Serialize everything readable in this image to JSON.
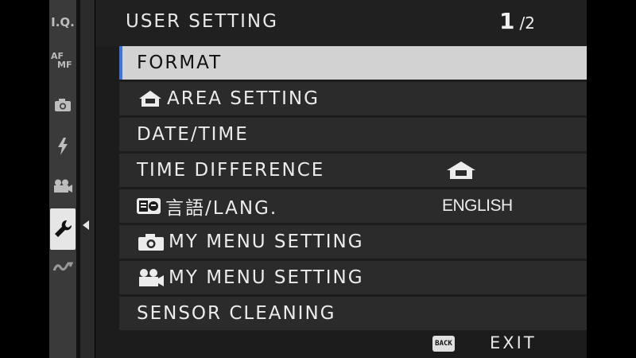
{
  "header": {
    "title": "USER SETTING",
    "page_current": "1",
    "page_separator": "/",
    "page_total": "2"
  },
  "tabs": [
    {
      "id": "iq",
      "label": "I.Q."
    },
    {
      "id": "af",
      "label_top": "AF",
      "label_bottom": "MF"
    },
    {
      "id": "shooting",
      "icon": "camera-icon"
    },
    {
      "id": "flash",
      "icon": "flash-icon"
    },
    {
      "id": "movie",
      "icon": "movie-icon"
    },
    {
      "id": "setup",
      "icon": "wrench-icon",
      "active": true
    },
    {
      "id": "connection",
      "icon": "connection-icon"
    }
  ],
  "menu": {
    "items": [
      {
        "label": "FORMAT",
        "value": "",
        "selected": true
      },
      {
        "label": "AREA SETTING",
        "icon": "home-icon",
        "value": ""
      },
      {
        "label": "DATE/TIME",
        "value": ""
      },
      {
        "label": "TIME DIFFERENCE",
        "value_icon": "home-icon",
        "value": ""
      },
      {
        "label": "言語/LANG.",
        "icon": "language-icon",
        "value": "ENGLISH"
      },
      {
        "label": "MY MENU SETTING",
        "icon": "camera-icon",
        "value": ""
      },
      {
        "label": "MY MENU SETTING",
        "icon": "movie-icon",
        "value": ""
      },
      {
        "label": "SENSOR CLEANING",
        "value": ""
      }
    ]
  },
  "footer": {
    "back_label": "BACK",
    "exit_label": "EXIT"
  },
  "colors": {
    "selected_bg": "#d2d2d2",
    "selection_accent": "#3f73d6",
    "item_bg": "#2b2b2b",
    "text": "#ececec"
  }
}
